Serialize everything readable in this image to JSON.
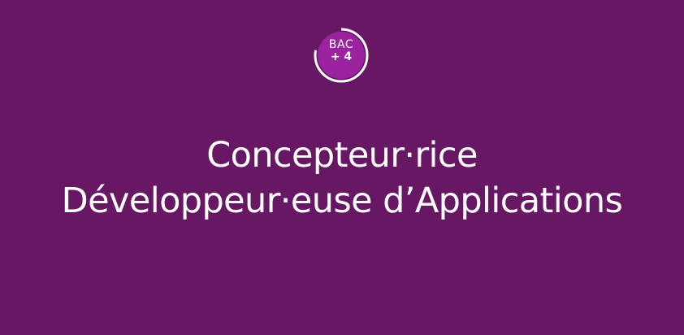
{
  "badge": {
    "line1": "BAC",
    "line2": "+ 4",
    "progress": 0.78,
    "fill_color": "#9b239f",
    "ring_color": "#ffffff"
  },
  "title": {
    "line1": "Concepteur·rice",
    "line2": "Développeur·euse d’Applications"
  },
  "colors": {
    "background": "#671763",
    "text": "#ffffff"
  }
}
